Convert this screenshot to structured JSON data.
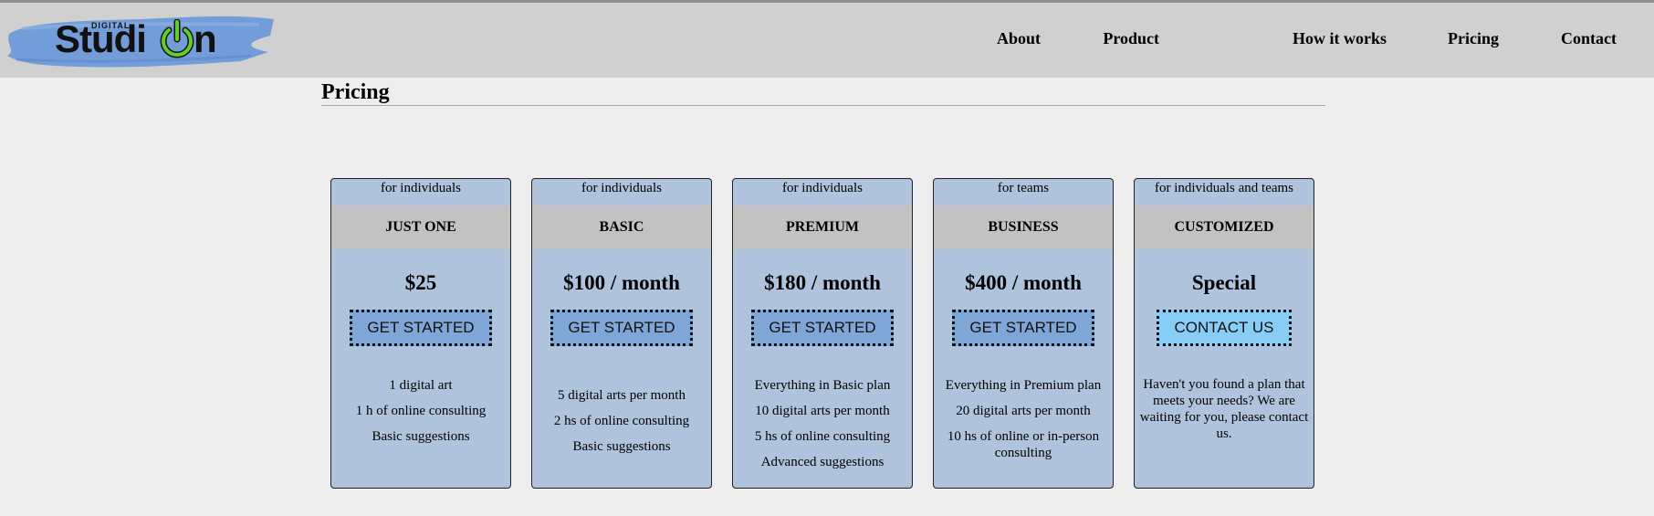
{
  "brand": {
    "name_main": "Studi",
    "name_suffix": "n",
    "tagline": "DIGITAL",
    "icon": "power-icon",
    "colors": {
      "brush": "#6e9ad8",
      "power": "#5fd02b"
    }
  },
  "nav": {
    "items": [
      {
        "label": "About"
      },
      {
        "label": "Product"
      },
      {
        "label": "How it works"
      },
      {
        "label": "Pricing"
      },
      {
        "label": "Contact"
      }
    ]
  },
  "page": {
    "title": "Pricing"
  },
  "plans": [
    {
      "audience": "for individuals",
      "name": "JUST ONE",
      "price": "$25",
      "cta": "GET STARTED",
      "features": [
        "1 digital art",
        "1 h of online consulting",
        "Basic suggestions"
      ]
    },
    {
      "audience": "for individuals",
      "name": "BASIC",
      "price": "$100 / month",
      "cta": "GET STARTED",
      "features": [
        "5 digital arts per month",
        "2 hs of online consulting",
        "Basic suggestions"
      ]
    },
    {
      "audience": "for individuals",
      "name": "PREMIUM",
      "price": "$180 / month",
      "cta": "GET STARTED",
      "features": [
        "Everything in Basic plan",
        "10 digital arts per month",
        "5 hs of online consulting",
        "Advanced suggestions"
      ]
    },
    {
      "audience": "for teams",
      "name": "BUSINESS",
      "price": "$400 / month",
      "cta": "GET STARTED",
      "features": [
        "Everything in Premium plan",
        "20 digital arts per month",
        "10 hs of online or in-person consulting"
      ]
    },
    {
      "audience": "for individuals and teams",
      "name": "CUSTOMIZED",
      "price": "Special",
      "cta": "CONTACT US",
      "note": "Haven't you found a plan that meets your needs? We are waiting for you, please contact us."
    }
  ],
  "colors": {
    "header_bg": "#d0d0d0",
    "page_bg": "#eeeeee",
    "card_bg": "#afc4dc",
    "card_header_bg": "#c2c2c2",
    "button_bg": "#7ea6d6",
    "contact_button_bg": "#87cdf6"
  }
}
